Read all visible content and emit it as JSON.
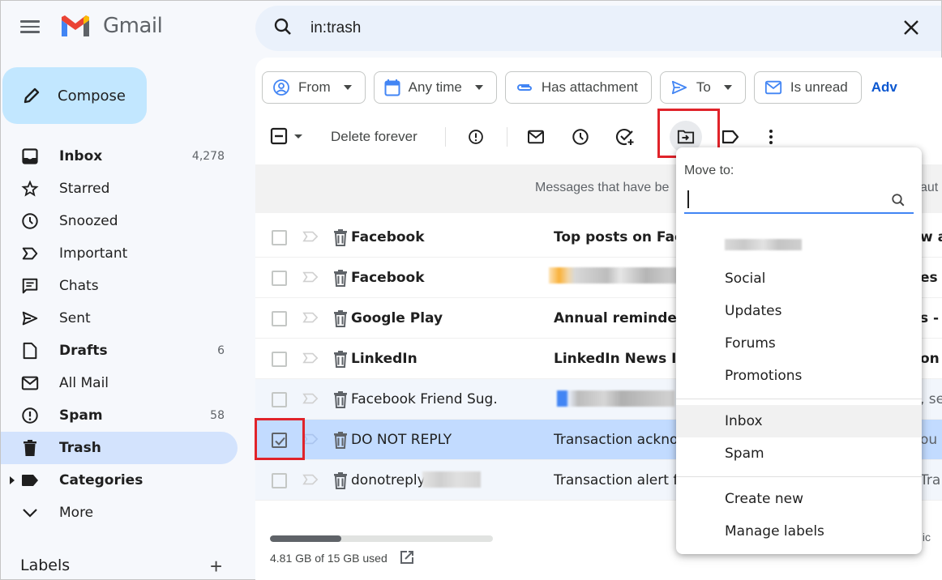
{
  "app": {
    "name": "Gmail"
  },
  "compose": {
    "label": "Compose"
  },
  "sidebar": {
    "items": [
      {
        "label": "Inbox",
        "count": "4,278",
        "icon": "inbox-icon",
        "bold": true
      },
      {
        "label": "Starred",
        "count": "",
        "icon": "star-icon",
        "bold": false
      },
      {
        "label": "Snoozed",
        "count": "",
        "icon": "clock-icon",
        "bold": false
      },
      {
        "label": "Important",
        "count": "",
        "icon": "important-icon",
        "bold": false
      },
      {
        "label": "Chats",
        "count": "",
        "icon": "chat-icon",
        "bold": false
      },
      {
        "label": "Sent",
        "count": "",
        "icon": "send-icon",
        "bold": false
      },
      {
        "label": "Drafts",
        "count": "6",
        "icon": "draft-icon",
        "bold": true
      },
      {
        "label": "All Mail",
        "count": "",
        "icon": "mail-icon",
        "bold": false
      },
      {
        "label": "Spam",
        "count": "58",
        "icon": "spam-icon",
        "bold": true
      },
      {
        "label": "Trash",
        "count": "",
        "icon": "trash-icon",
        "bold": true,
        "active": true
      },
      {
        "label": "Categories",
        "count": "",
        "icon": "label-icon",
        "bold": true
      },
      {
        "label": "More",
        "count": "",
        "icon": "chevron-down-icon",
        "bold": false
      }
    ],
    "labels_heading": "Labels",
    "labels_add": "+"
  },
  "search": {
    "query": "in:trash"
  },
  "filters": {
    "chips": [
      {
        "label": "From",
        "icon": "person-icon",
        "dropdown": true
      },
      {
        "label": "Any time",
        "icon": "calendar-icon",
        "dropdown": true
      },
      {
        "label": "Has attachment",
        "icon": "attachment-icon",
        "dropdown": false
      },
      {
        "label": "To",
        "icon": "send-icon",
        "dropdown": true
      },
      {
        "label": "Is unread",
        "icon": "mail-icon",
        "dropdown": false
      }
    ],
    "advanced_link": "Adv"
  },
  "toolbar": {
    "delete_forever": "Delete forever"
  },
  "notice": {
    "text": "Messages that have be",
    "tail": "aut"
  },
  "messages": [
    {
      "sender": "Facebook",
      "subject": "Top posts on Face",
      "tail": "w a",
      "unread": true,
      "selected": false,
      "subject_blurred": false
    },
    {
      "sender": "Facebook",
      "subject": "",
      "tail": "es -",
      "unread": true,
      "selected": false,
      "subject_blurred": true
    },
    {
      "sender": "Google Play",
      "subject": "Annual reminder a",
      "tail": "s - I",
      "unread": true,
      "selected": false,
      "subject_blurred": false
    },
    {
      "sender": "LinkedIn",
      "subject": "LinkedIn News Inc",
      "tail": "on L",
      "unread": true,
      "selected": false,
      "subject_blurred": false
    },
    {
      "sender": "Facebook Friend Sug.",
      "subject": "",
      "tail": ", se",
      "unread": false,
      "selected": false,
      "subject_blurred": true
    },
    {
      "sender": "DO NOT REPLY",
      "subject": "Transaction acknow",
      "tail": "ou fo",
      "unread": false,
      "selected": true,
      "subject_blurred": false
    },
    {
      "sender": "donotreply",
      "subject": "Transaction alert fo",
      "tail": "Tra",
      "unread": false,
      "selected": false,
      "subject_blurred": false
    }
  ],
  "storage": {
    "text": "4.81 GB of 15 GB used",
    "used_fraction": 0.32
  },
  "footer": {
    "policy_fragment": "olic"
  },
  "move_to_popup": {
    "title": "Move to:",
    "search_value": "",
    "items": [
      "Social",
      "Updates",
      "Forums",
      "Promotions"
    ],
    "system_items": [
      "Inbox",
      "Spam"
    ],
    "actions": [
      "Create new",
      "Manage labels"
    ],
    "hovered": "Inbox"
  },
  "colors": {
    "accent": "#0b57d0",
    "compose_bg": "#c2e7ff",
    "active_nav": "#d3e3fd",
    "selected_row": "#c2dbff",
    "highlight_box": "#e0232a"
  }
}
